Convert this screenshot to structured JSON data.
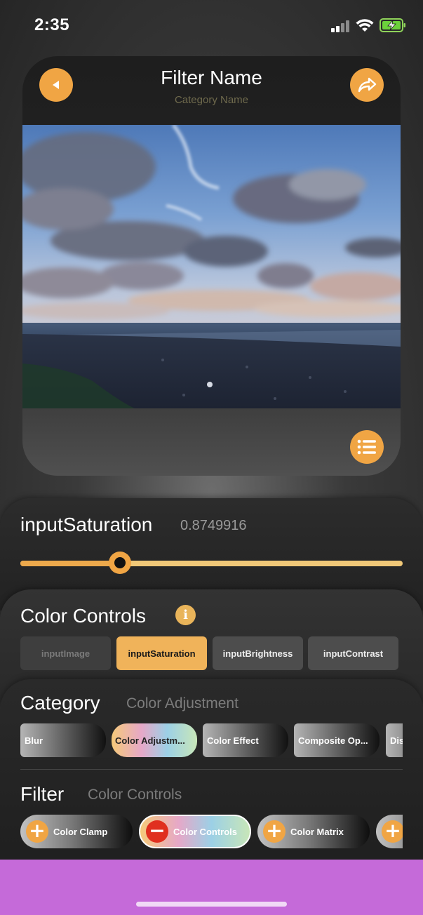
{
  "status_bar": {
    "time": "2:35"
  },
  "preview": {
    "title": "Filter Name",
    "subtitle": "Category Name",
    "back_icon": "play-left-icon",
    "share_icon": "share-arrow-icon",
    "list_icon": "list-icon"
  },
  "parameter": {
    "name": "inputSaturation",
    "value_text": "0.8749916",
    "slider_fraction": 0.26
  },
  "filter_info": {
    "title": "Color Controls",
    "info_icon": "i",
    "inputs": [
      {
        "label": "inputImage",
        "state": "disabled"
      },
      {
        "label": "inputSaturation",
        "state": "selected"
      },
      {
        "label": "inputBrightness",
        "state": "normal"
      },
      {
        "label": "inputContrast",
        "state": "normal"
      }
    ]
  },
  "category": {
    "title": "Category",
    "selected": "Color Adjustment",
    "items": [
      {
        "label": "Blur",
        "selected": false
      },
      {
        "label": "Color Adjustm...",
        "selected": true
      },
      {
        "label": "Color Effect",
        "selected": false
      },
      {
        "label": "Composite Op...",
        "selected": false
      },
      {
        "label": "Dis",
        "selected": false
      }
    ]
  },
  "filter": {
    "title": "Filter",
    "selected": "Color Controls",
    "items": [
      {
        "label": "Color Clamp",
        "action": "+",
        "selected": false
      },
      {
        "label": "Color Controls",
        "action": "−",
        "selected": true
      },
      {
        "label": "Color Matrix",
        "action": "+",
        "selected": false
      },
      {
        "label": "",
        "action": "+",
        "selected": false
      }
    ]
  },
  "colors": {
    "accent": "#f0a544",
    "remove": "#e02f1f",
    "home_bar_bg": "#c56ad9"
  }
}
